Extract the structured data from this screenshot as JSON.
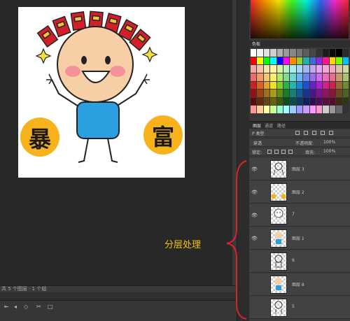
{
  "canvas": {
    "status_text": "共 5 个图层 · 1 个组",
    "badge_left": "暴",
    "badge_right": "富"
  },
  "timeline": {
    "controls": [
      "⇤",
      "◂",
      "◇",
      "✂",
      "□"
    ]
  },
  "swatches_panel": {
    "title": "色板",
    "colors": [
      "#ffffff",
      "#f2f2f2",
      "#e0e0e0",
      "#cfcfcf",
      "#b0b0b0",
      "#9a9a9a",
      "#888888",
      "#767676",
      "#5d5d5d",
      "#474747",
      "#333333",
      "#1d1d1d",
      "#0b0b0b",
      "#000000",
      "#2b2b2b",
      "#ff0000",
      "#ffff00",
      "#00ff00",
      "#00ffff",
      "#0000ff",
      "#ff00ff",
      "#ff8c00",
      "#9acd32",
      "#20b2aa",
      "#4169e1",
      "#8a2be2",
      "#ff1493",
      "#ffd700",
      "#7cfc00",
      "#00bfff",
      "#f4a6a6",
      "#f7c3a6",
      "#fbe3a6",
      "#fff6a6",
      "#d8f5a6",
      "#b6f0c0",
      "#a6ecea",
      "#a6d8f6",
      "#a6b8f4",
      "#c2a6f4",
      "#e2a6f4",
      "#f4a6d8",
      "#f4a6bc",
      "#d9c4a8",
      "#c9d9a8",
      "#ec6b6b",
      "#f09a6b",
      "#f5c86b",
      "#fbee6b",
      "#b8e86b",
      "#7fdc8a",
      "#6bd7d3",
      "#6bb4ef",
      "#6b86eb",
      "#9b6beb",
      "#cf6beb",
      "#eb6bb8",
      "#eb6b8b",
      "#c49a6f",
      "#a8c46f",
      "#d11e1e",
      "#e0601e",
      "#e9a21e",
      "#f2e21e",
      "#8bcf1e",
      "#24b83b",
      "#1eb7b0",
      "#1e84d8",
      "#1e4fd4",
      "#6a1ed4",
      "#b01ed4",
      "#d41e90",
      "#d41e4e",
      "#9a6a32",
      "#6e8c32",
      "#901414",
      "#9c4214",
      "#a27014",
      "#a89c14",
      "#5e8e14",
      "#187e28",
      "#147e78",
      "#145c96",
      "#143690",
      "#4a1490",
      "#7a1490",
      "#901462",
      "#901436",
      "#6a4a22",
      "#4c6222",
      "#5a0c0c",
      "#62290c",
      "#66460c",
      "#6a620c",
      "#3a5a0c",
      "#0e4e18",
      "#0c4e4a",
      "#0c3a5e",
      "#0c225a",
      "#2e0c5a",
      "#4c0c5a",
      "#5a0c3e",
      "#5a0c22",
      "#3e2a14",
      "#2c3814",
      "#ff9999",
      "#ffcc99",
      "#ffff99",
      "#ccff99",
      "#99ffcc",
      "#99ffff",
      "#99ccff",
      "#9999ff",
      "#cc99ff",
      "#ff99ff",
      "#ff99cc",
      "#cccccc",
      "#999999",
      "#666666",
      "#333333"
    ]
  },
  "layers_panel": {
    "tabs": [
      "图层",
      "通道",
      "路径"
    ],
    "filter_label": "P 类型",
    "blend_mode": "穿透",
    "opacity_label": "不透明度:",
    "opacity_value": "100%",
    "lock_label": "锁定:",
    "fill_label": "填充:",
    "fill_value": "100%",
    "layers": [
      {
        "name": "图层 3",
        "visible": true
      },
      {
        "name": "图层 2",
        "visible": true
      },
      {
        "name": "7",
        "visible": true
      },
      {
        "name": "图层 1",
        "visible": true
      },
      {
        "name": "6",
        "visible": false
      },
      {
        "name": "图层 8",
        "visible": false
      },
      {
        "name": "5",
        "visible": false
      }
    ]
  },
  "annotation": {
    "label": "分层处理",
    "color": "#f5c400"
  }
}
